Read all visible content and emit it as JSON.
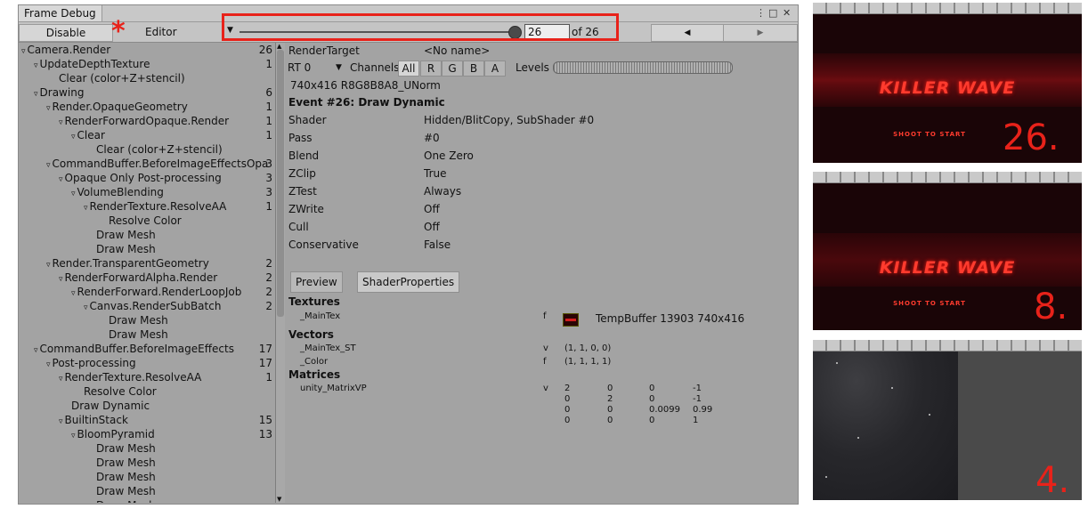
{
  "window": {
    "title": "Frame Debug",
    "toolbar": {
      "disable_label": "Disable",
      "editor_label": "Editor",
      "frame_value": "26",
      "frame_of": "of 26"
    }
  },
  "annotation": {
    "asterisk": "*"
  },
  "tree": [
    {
      "label": "Camera.Render",
      "count": "26",
      "depth": 0,
      "tri": true
    },
    {
      "label": "UpdateDepthTexture",
      "count": "1",
      "depth": 1,
      "tri": true
    },
    {
      "label": "Clear (color+Z+stencil)",
      "count": "",
      "depth": 3,
      "tri": false
    },
    {
      "label": "Drawing",
      "count": "6",
      "depth": 1,
      "tri": true
    },
    {
      "label": "Render.OpaqueGeometry",
      "count": "1",
      "depth": 2,
      "tri": true
    },
    {
      "label": "RenderForwardOpaque.Render",
      "count": "1",
      "depth": 3,
      "tri": true
    },
    {
      "label": "Clear",
      "count": "1",
      "depth": 4,
      "tri": true
    },
    {
      "label": "Clear (color+Z+stencil)",
      "count": "",
      "depth": 6,
      "tri": false
    },
    {
      "label": "CommandBuffer.BeforeImageEffectsOpa",
      "count": "3",
      "depth": 2,
      "tri": true
    },
    {
      "label": "Opaque Only Post-processing",
      "count": "3",
      "depth": 3,
      "tri": true
    },
    {
      "label": "VolumeBlending",
      "count": "3",
      "depth": 4,
      "tri": true
    },
    {
      "label": "RenderTexture.ResolveAA",
      "count": "1",
      "depth": 5,
      "tri": true
    },
    {
      "label": "Resolve Color",
      "count": "",
      "depth": 7,
      "tri": false
    },
    {
      "label": "Draw Mesh",
      "count": "",
      "depth": 6,
      "tri": false
    },
    {
      "label": "Draw Mesh",
      "count": "",
      "depth": 6,
      "tri": false
    },
    {
      "label": "Render.TransparentGeometry",
      "count": "2",
      "depth": 2,
      "tri": true
    },
    {
      "label": "RenderForwardAlpha.Render",
      "count": "2",
      "depth": 3,
      "tri": true
    },
    {
      "label": "RenderForward.RenderLoopJob",
      "count": "2",
      "depth": 4,
      "tri": true
    },
    {
      "label": "Canvas.RenderSubBatch",
      "count": "2",
      "depth": 5,
      "tri": true
    },
    {
      "label": "Draw Mesh",
      "count": "",
      "depth": 7,
      "tri": false
    },
    {
      "label": "Draw Mesh",
      "count": "",
      "depth": 7,
      "tri": false
    },
    {
      "label": "CommandBuffer.BeforeImageEffects",
      "count": "17",
      "depth": 1,
      "tri": true
    },
    {
      "label": "Post-processing",
      "count": "17",
      "depth": 2,
      "tri": true
    },
    {
      "label": "RenderTexture.ResolveAA",
      "count": "1",
      "depth": 3,
      "tri": true
    },
    {
      "label": "Resolve Color",
      "count": "",
      "depth": 5,
      "tri": false
    },
    {
      "label": "Draw Dynamic",
      "count": "",
      "depth": 4,
      "tri": false
    },
    {
      "label": "BuiltinStack",
      "count": "15",
      "depth": 3,
      "tri": true
    },
    {
      "label": "BloomPyramid",
      "count": "13",
      "depth": 4,
      "tri": true
    },
    {
      "label": "Draw Mesh",
      "count": "",
      "depth": 6,
      "tri": false
    },
    {
      "label": "Draw Mesh",
      "count": "",
      "depth": 6,
      "tri": false
    },
    {
      "label": "Draw Mesh",
      "count": "",
      "depth": 6,
      "tri": false
    },
    {
      "label": "Draw Mesh",
      "count": "",
      "depth": 6,
      "tri": false
    },
    {
      "label": "Draw Mesh",
      "count": "",
      "depth": 6,
      "tri": false
    }
  ],
  "detail": {
    "render_target_label": "RenderTarget",
    "render_target_value": "<No name>",
    "rt_select": "RT 0",
    "channels_label": "Channels",
    "channels": [
      "All",
      "R",
      "G",
      "B",
      "A"
    ],
    "levels_label": "Levels",
    "format": "740x416 R8G8B8A8_UNorm",
    "event_title": "Event #26: Draw Dynamic",
    "properties": [
      {
        "name": "Shader",
        "value": "Hidden/BlitCopy, SubShader #0"
      },
      {
        "name": "Pass",
        "value": "#0"
      },
      {
        "name": "Blend",
        "value": "One Zero"
      },
      {
        "name": "ZClip",
        "value": "True"
      },
      {
        "name": "ZTest",
        "value": "Always"
      },
      {
        "name": "ZWrite",
        "value": "Off"
      },
      {
        "name": "Cull",
        "value": "Off"
      },
      {
        "name": "Conservative",
        "value": "False"
      }
    ],
    "tabs": [
      "Preview",
      "ShaderProperties"
    ],
    "textures_header": "Textures",
    "texture": {
      "name": "_MainTex",
      "type": "f",
      "value": "TempBuffer 13903 740x416"
    },
    "vectors_header": "Vectors",
    "vectors": [
      {
        "name": "_MainTex_ST",
        "type": "v",
        "value": "(1, 1, 0, 0)"
      },
      {
        "name": "_Color",
        "type": "f",
        "value": "(1, 1, 1, 1)"
      }
    ],
    "matrices_header": "Matrices",
    "matrix": {
      "name": "unity_MatrixVP",
      "type": "v",
      "rows": [
        [
          "2",
          "0",
          "0",
          "-1"
        ],
        [
          "0",
          "2",
          "0",
          "-1"
        ],
        [
          "0",
          "0",
          "0.0099",
          "0.99"
        ],
        [
          "0",
          "0",
          "0",
          "1"
        ]
      ]
    }
  },
  "previews": [
    {
      "title": "KILLER WAVE",
      "subtitle": "SHOOT TO START",
      "number": "26."
    },
    {
      "title": "KILLER WAVE",
      "subtitle": "SHOOT TO START",
      "number": "8."
    },
    {
      "number": "4."
    }
  ],
  "colors": {
    "annotation_red": "#e8221a",
    "game_red": "#ff3b2e",
    "game_bg": "#1a0507"
  }
}
